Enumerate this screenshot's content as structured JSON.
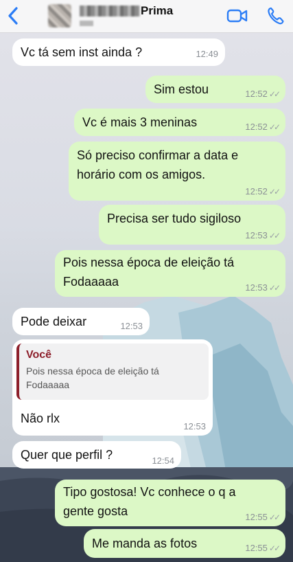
{
  "header": {
    "contact_name": "Prima",
    "back_icon": "chevron-left-icon",
    "video_icon": "video-camera-icon",
    "phone_icon": "phone-icon",
    "accent_color": "#2a7cf6"
  },
  "messages": [
    {
      "direction": "incoming",
      "text": "Vc tá sem inst ainda ?",
      "time": "12:49"
    },
    {
      "direction": "outgoing",
      "text": "Sim estou",
      "time": "12:52"
    },
    {
      "direction": "outgoing",
      "text": "Vc é mais 3 meninas",
      "time": "12:52"
    },
    {
      "direction": "outgoing",
      "text": "Só preciso confirmar a data e horário com os amigos.",
      "time": "12:52"
    },
    {
      "direction": "outgoing",
      "text": "Precisa ser tudo sigiloso",
      "time": "12:53"
    },
    {
      "direction": "outgoing",
      "text": "Pois nessa época de eleição tá Fodaaaaa",
      "time": "12:53"
    },
    {
      "direction": "incoming",
      "text": "Pode deixar",
      "time": "12:53"
    },
    {
      "direction": "incoming",
      "text": "Não rlx",
      "time": "12:53",
      "quote": {
        "author": "Você",
        "text": "Pois nessa época de eleição tá Fodaaaaa"
      }
    },
    {
      "direction": "incoming",
      "text": "Quer que perfil ?",
      "time": "12:54"
    },
    {
      "direction": "outgoing",
      "text": "Tipo gostosa! Vc conhece o q a gente gosta",
      "time": "12:55"
    },
    {
      "direction": "outgoing",
      "text": "Me manda as fotos",
      "time": "12:55"
    }
  ],
  "colors": {
    "incoming_bubble": "#ffffff",
    "outgoing_bubble": "#dcf8c6",
    "quote_author": "#8d1f2b"
  }
}
